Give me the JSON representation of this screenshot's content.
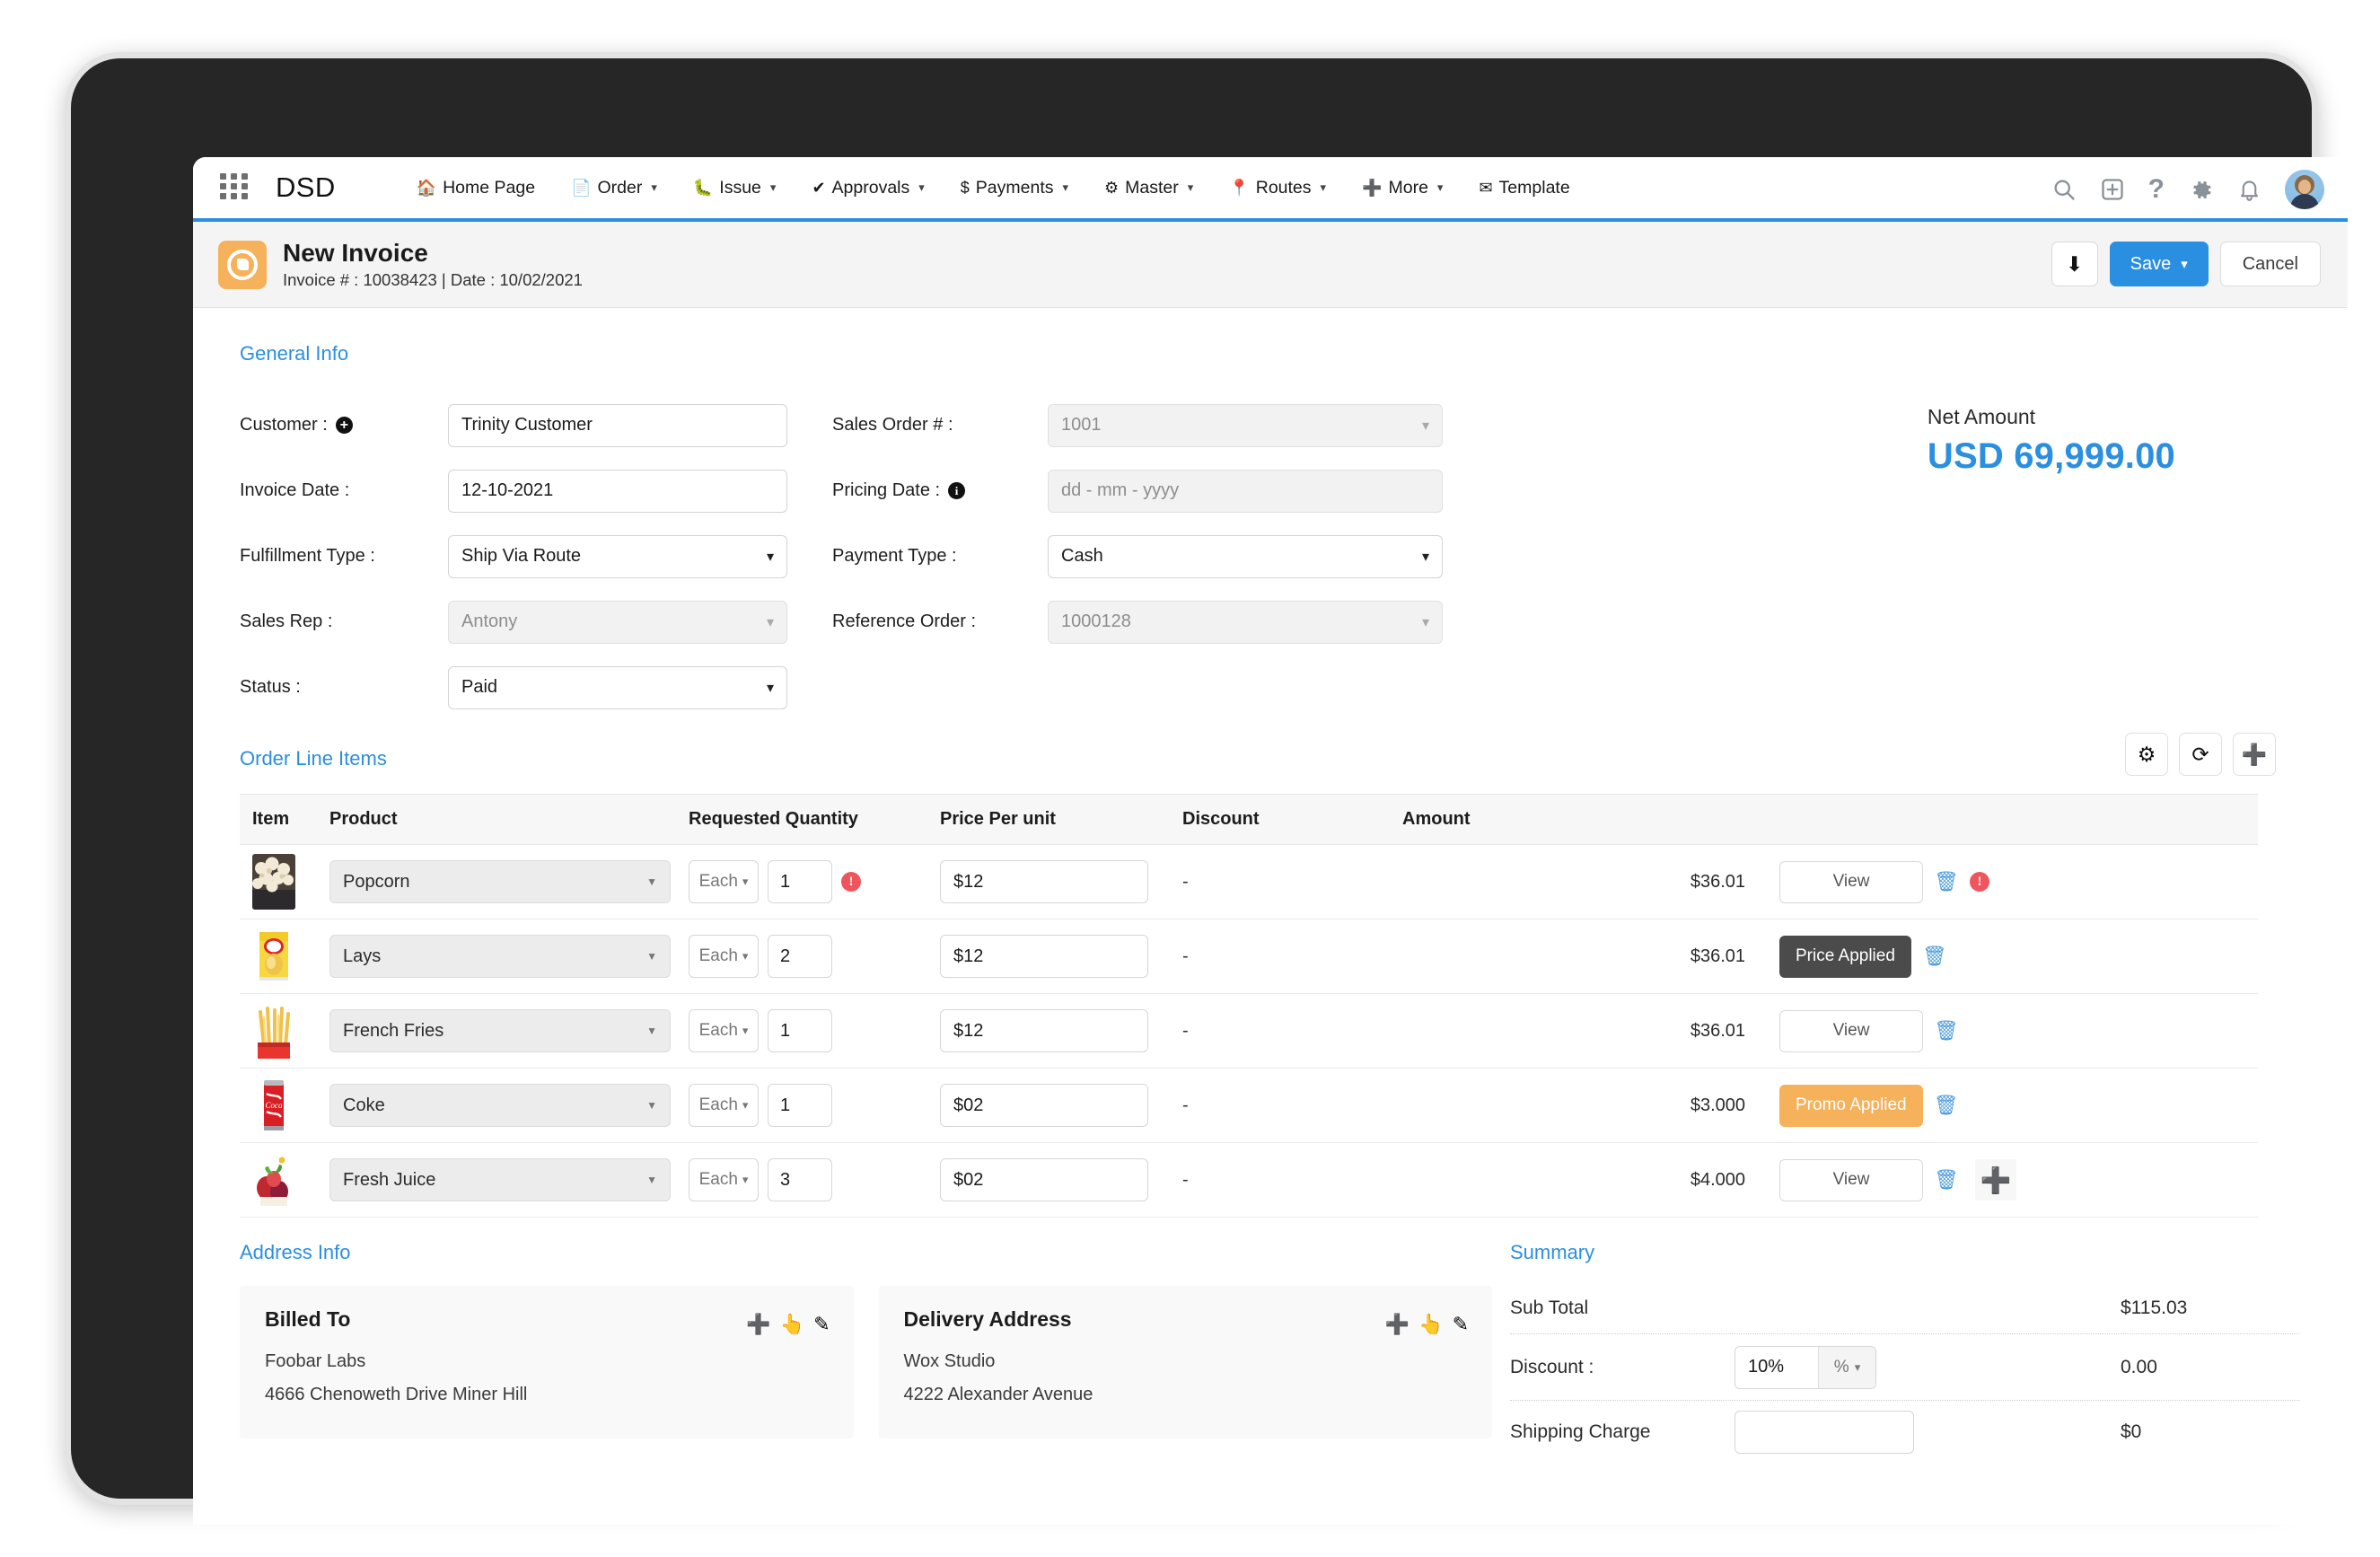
{
  "topnav": {
    "brand": "DSD",
    "waffle_icon": "grid-apps-icon",
    "items": [
      {
        "label": "Home Page",
        "icon": "home-icon",
        "caret": false
      },
      {
        "label": "Order",
        "icon": "file-icon",
        "caret": true
      },
      {
        "label": "Issue",
        "icon": "bug-icon",
        "caret": true
      },
      {
        "label": "Approvals",
        "icon": "check-icon",
        "caret": true
      },
      {
        "label": "Payments",
        "icon": "dollar-icon",
        "caret": true
      },
      {
        "label": "Master",
        "icon": "gear-icon",
        "caret": true
      },
      {
        "label": "Routes",
        "icon": "map-pin-icon",
        "caret": true
      },
      {
        "label": "More",
        "icon": "plus-circle-icon",
        "caret": true
      },
      {
        "label": "Template",
        "icon": "envelope-icon",
        "caret": false
      }
    ],
    "right_icons": [
      "search-icon",
      "add-box-icon",
      "help-icon",
      "gear-icon",
      "bell-icon",
      "avatar"
    ]
  },
  "pagehead": {
    "icon": "invoice-badge-icon",
    "title": "New Invoice",
    "subtitle": "Invoice # : 10038423 | Date : 10/02/2021",
    "download_label": "download-icon",
    "save_label": "Save",
    "save_caret": "⌄",
    "cancel_label": "Cancel"
  },
  "general_info": {
    "section_title": "General Info",
    "left_fields": [
      {
        "label": "Customer :",
        "value": "Trinity Customer",
        "type": "text",
        "readonly": false,
        "adornment": "plus-circle-icon"
      },
      {
        "label": "Invoice Date :",
        "value": "12-10-2021",
        "type": "text",
        "readonly": false,
        "adornment": ""
      },
      {
        "label": "Fulfillment Type :",
        "value": "Ship Via Route",
        "type": "select",
        "readonly": false,
        "adornment": ""
      },
      {
        "label": "Sales Rep :",
        "value": "Antony",
        "type": "select",
        "readonly": true,
        "adornment": ""
      },
      {
        "label": "Status :",
        "value": "Paid",
        "type": "select",
        "readonly": false,
        "adornment": ""
      }
    ],
    "right_fields": [
      {
        "label": "Sales Order # :",
        "value": "1001",
        "type": "select",
        "readonly": true,
        "adornment": ""
      },
      {
        "label": "Pricing Date :",
        "value": "dd - mm - yyyy",
        "type": "text",
        "readonly": false,
        "placeholder": true,
        "adornment": "info-icon"
      },
      {
        "label": "Payment Type :",
        "value": "Cash",
        "type": "select",
        "readonly": false,
        "adornment": ""
      },
      {
        "label": "Reference Order :",
        "value": "1000128",
        "type": "select",
        "readonly": true,
        "adornment": ""
      }
    ]
  },
  "net_amount": {
    "label": "Net Amount",
    "value": "USD 69,999.00"
  },
  "line_items": {
    "section_title": "Order Line Items",
    "tools": [
      "gear-icon",
      "refresh-icon",
      "add-circle-icon"
    ],
    "columns": [
      "Item",
      "Product",
      "Requested Quantity",
      "Price Per unit",
      "Discount",
      "Amount",
      ""
    ],
    "rows": [
      {
        "thumb": "popcorn-thumb",
        "product": "Popcorn",
        "uom": "Each",
        "qty": "1",
        "qty_warning": true,
        "price": "$12",
        "discount": "-",
        "amount": "$36.01",
        "action_label": "View",
        "action_style": "view",
        "has_warning_icon": true,
        "has_add": false
      },
      {
        "thumb": "lays-thumb",
        "product": "Lays",
        "uom": "Each",
        "qty": "2",
        "qty_warning": false,
        "price": "$12",
        "discount": "-",
        "amount": "$36.01",
        "action_label": "Price Applied",
        "action_style": "dark",
        "has_warning_icon": false,
        "has_add": false
      },
      {
        "thumb": "fries-thumb",
        "product": "French Fries",
        "uom": "Each",
        "qty": "1",
        "qty_warning": false,
        "price": "$12",
        "discount": "-",
        "amount": "$36.01",
        "action_label": "View",
        "action_style": "view",
        "has_warning_icon": false,
        "has_add": false
      },
      {
        "thumb": "coke-thumb",
        "product": "Coke",
        "uom": "Each",
        "qty": "1",
        "qty_warning": false,
        "price": "$02",
        "discount": "-",
        "amount": "$3.000",
        "action_label": "Promo Applied",
        "action_style": "orange",
        "has_warning_icon": false,
        "has_add": false
      },
      {
        "thumb": "juice-thumb",
        "product": "Fresh Juice",
        "uom": "Each",
        "qty": "3",
        "qty_warning": false,
        "price": "$02",
        "discount": "-",
        "amount": "$4.000",
        "action_label": "View",
        "action_style": "view",
        "has_warning_icon": false,
        "has_add": true
      }
    ]
  },
  "address_info": {
    "section_title": "Address Info",
    "cards": [
      {
        "title": "Billed To",
        "line1": "Foobar Labs",
        "line2": "4666 Chenoweth Drive Miner Hill",
        "actions": [
          "plus-icon",
          "hand-pointer-icon",
          "pencil-icon"
        ]
      },
      {
        "title": "Delivery Address",
        "line1": "Wox Studio",
        "line2": "4222 Alexander Avenue",
        "actions": [
          "plus-icon",
          "hand-pointer-icon",
          "pencil-icon"
        ]
      }
    ]
  },
  "summary": {
    "section_title": "Summary",
    "rows": [
      {
        "label": "Sub Total",
        "input": null,
        "unit": null,
        "value": "$115.03"
      },
      {
        "label": "Discount :",
        "input": "10%",
        "unit": "%",
        "value": "0.00"
      },
      {
        "label": "Shipping Charge",
        "input": "",
        "unit": null,
        "value": "$0"
      }
    ]
  },
  "colors": {
    "accent_blue": "#2a8fe0",
    "brand_orange": "#f6b15b",
    "warning_red": "#f0545c",
    "dark_badge": "#4b4b4b"
  }
}
